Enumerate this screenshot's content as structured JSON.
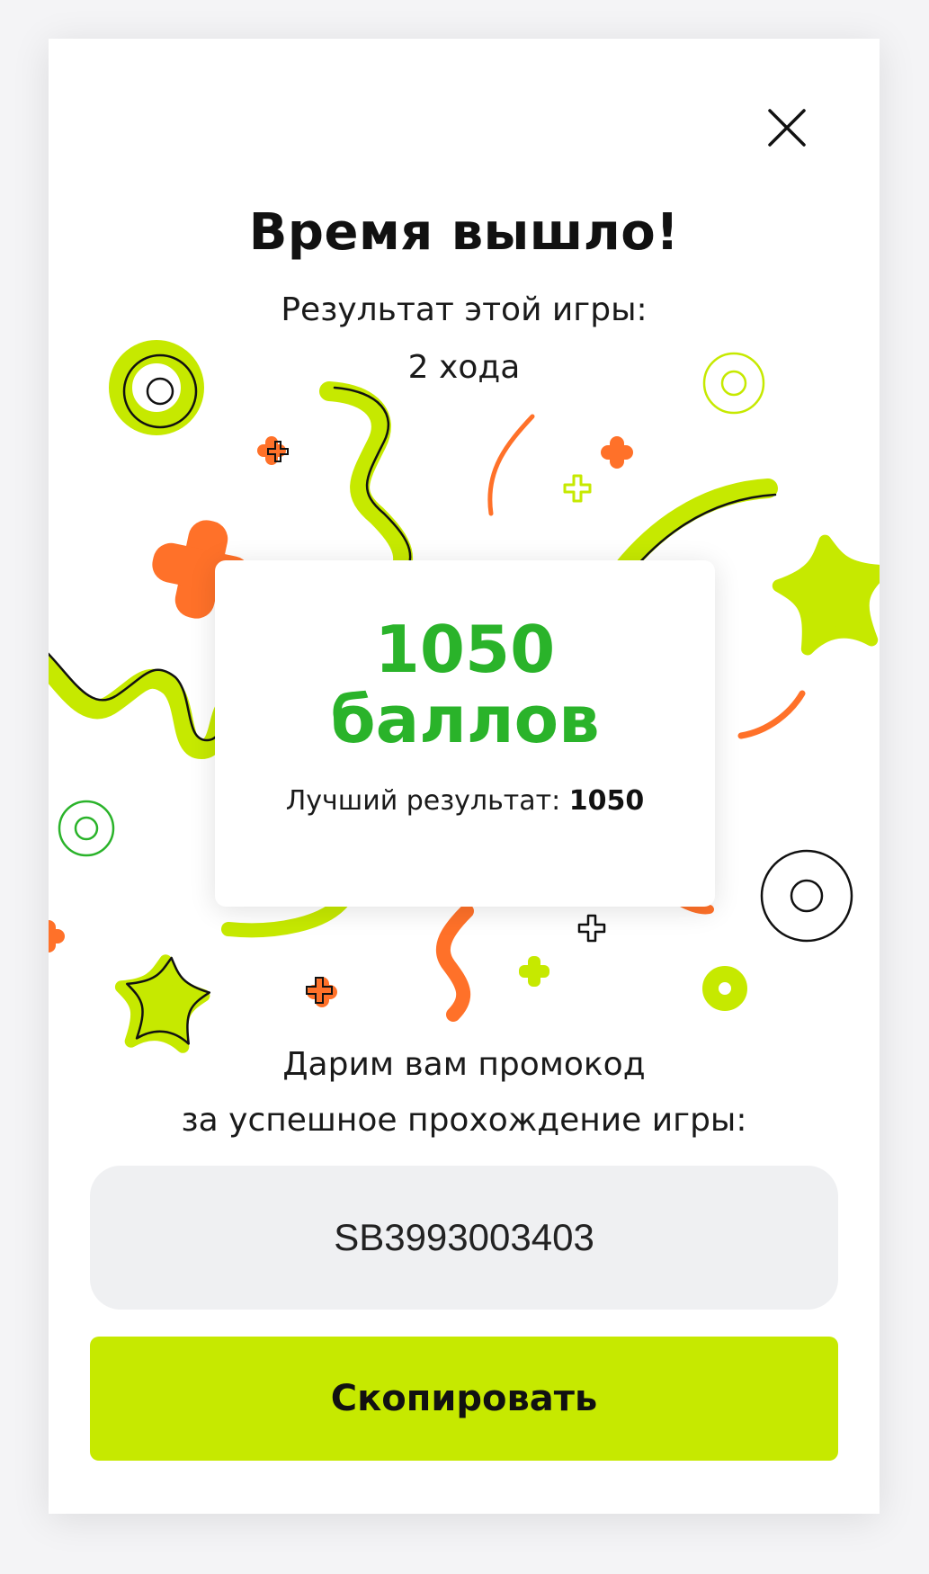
{
  "colors": {
    "accent_lime": "#c6e900",
    "accent_orange": "#ff7129",
    "score_green": "#2ab32a",
    "promo_bg": "#eff0f2"
  },
  "header": {
    "close_icon": "close-icon",
    "title": "Время вышло!",
    "result_label": "Результат этой игры:",
    "moves": "2 хода"
  },
  "score": {
    "points": "1050",
    "unit": "баллов",
    "best_label": "Лучший результат:",
    "best_value": "1050"
  },
  "promo": {
    "line1": "Дарим вам промокод",
    "line2": "за успешное прохождение игры:",
    "code": "SB3993003403",
    "copy_label": "Скопировать"
  }
}
